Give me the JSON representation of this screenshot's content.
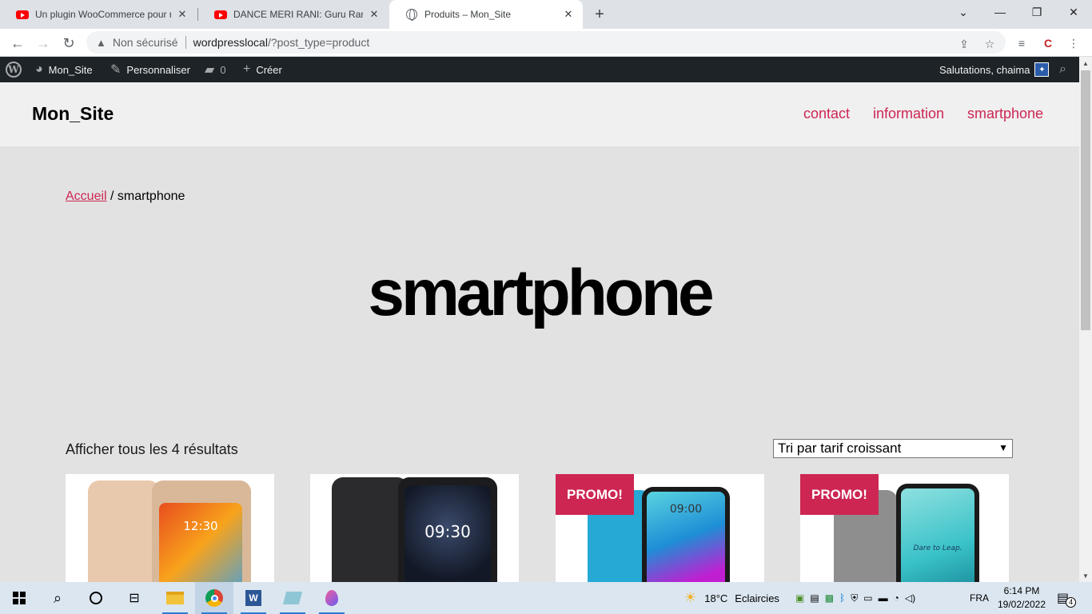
{
  "browser": {
    "tabs": [
      {
        "title": "Un plugin WooCommerce pour m",
        "icon": "youtube-icon",
        "active": false
      },
      {
        "title": "DANCE MERI RANI: Guru Randhaw",
        "icon": "youtube-icon",
        "active": false
      },
      {
        "title": "Produits – Mon_Site",
        "icon": "globe-icon",
        "active": true
      }
    ],
    "security_label": "Non sécurisé",
    "url_host": "wordpresslocal",
    "url_path": "/?post_type=product"
  },
  "adminbar": {
    "site_name": "Mon_Site",
    "customize": "Personnaliser",
    "comments_count": "0",
    "new": "Créer",
    "greeting": "Salutations, chaima"
  },
  "site": {
    "title": "Mon_Site",
    "menu": [
      "contact",
      "information",
      "smartphone"
    ],
    "accent_color": "#cd2653"
  },
  "breadcrumb": {
    "home": "Accueil",
    "separator": " / ",
    "current": "smartphone"
  },
  "archive": {
    "title": "smartphone",
    "result_count": "Afficher tous les 4 résultats",
    "orderby": "Tri par tarif croissant"
  },
  "products": [
    {
      "badge": "",
      "screen_time": "12:30"
    },
    {
      "badge": "",
      "screen_time": "09:30"
    },
    {
      "badge": "PROMO!",
      "screen_time": "09:00"
    },
    {
      "badge": "PROMO!",
      "screen_time": "Dare to Leap."
    }
  ],
  "taskbar": {
    "weather_temp": "18°C",
    "weather_text": "Eclaircies",
    "language": "FRA",
    "time": "6:14 PM",
    "date": "19/02/2022",
    "notifications": "4"
  }
}
